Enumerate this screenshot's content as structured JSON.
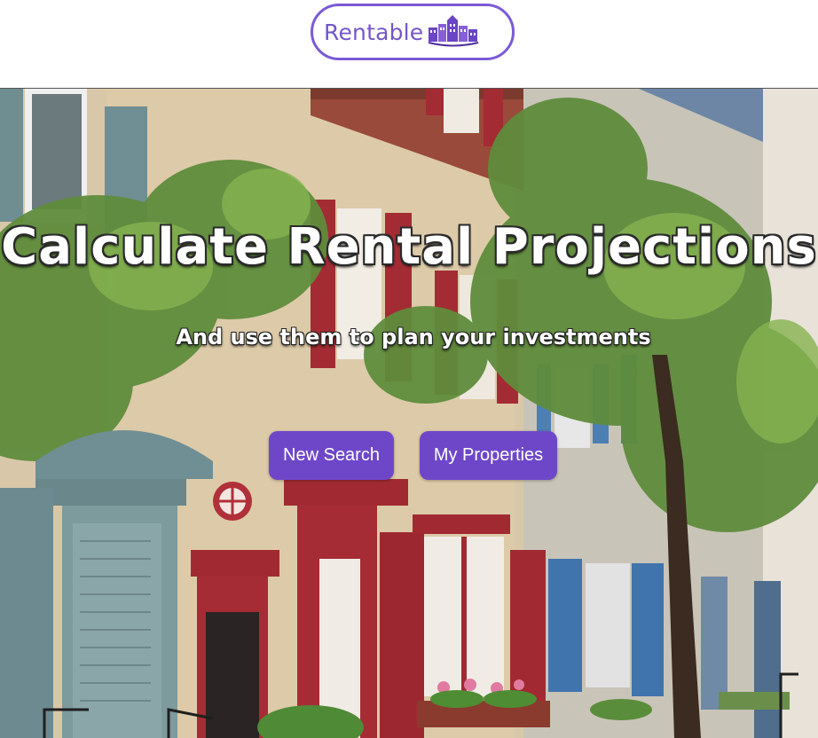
{
  "header": {
    "logo_text": "Rentable"
  },
  "hero": {
    "title": "Calculate Rental Projections",
    "subtitle": "And use them to plan your investments"
  },
  "actions": {
    "new_search_label": "New Search",
    "my_properties_label": "My Properties"
  },
  "colors": {
    "brand_purple": "#6e47c9",
    "logo_border": "#7b5ad6"
  }
}
